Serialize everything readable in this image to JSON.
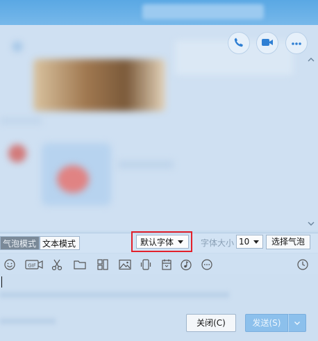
{
  "toolbar": {
    "bubble_mode": "气泡模式",
    "text_mode": "文本模式",
    "font_name": "默认字体",
    "font_size_label": "字体大小",
    "font_size": "10",
    "choose_bubble": "选择气泡"
  },
  "actions": {
    "close": "关闭(C)",
    "send": "发送(S)"
  },
  "icons": {
    "header": [
      "phone-icon",
      "video-icon",
      "more-icon"
    ],
    "input_bar": [
      "emoji-icon",
      "gif-icon",
      "scissors-icon",
      "folder-icon",
      "template-icon",
      "image-icon",
      "shake-icon",
      "calendar-icon",
      "music-icon",
      "more-circle-icon",
      "history-clock-icon"
    ]
  },
  "colors": {
    "titlebar": "#5aa8e4",
    "chat_background": "#cfe0f2",
    "highlight_border": "#e3202a",
    "send_button": "#8cc0ec"
  }
}
